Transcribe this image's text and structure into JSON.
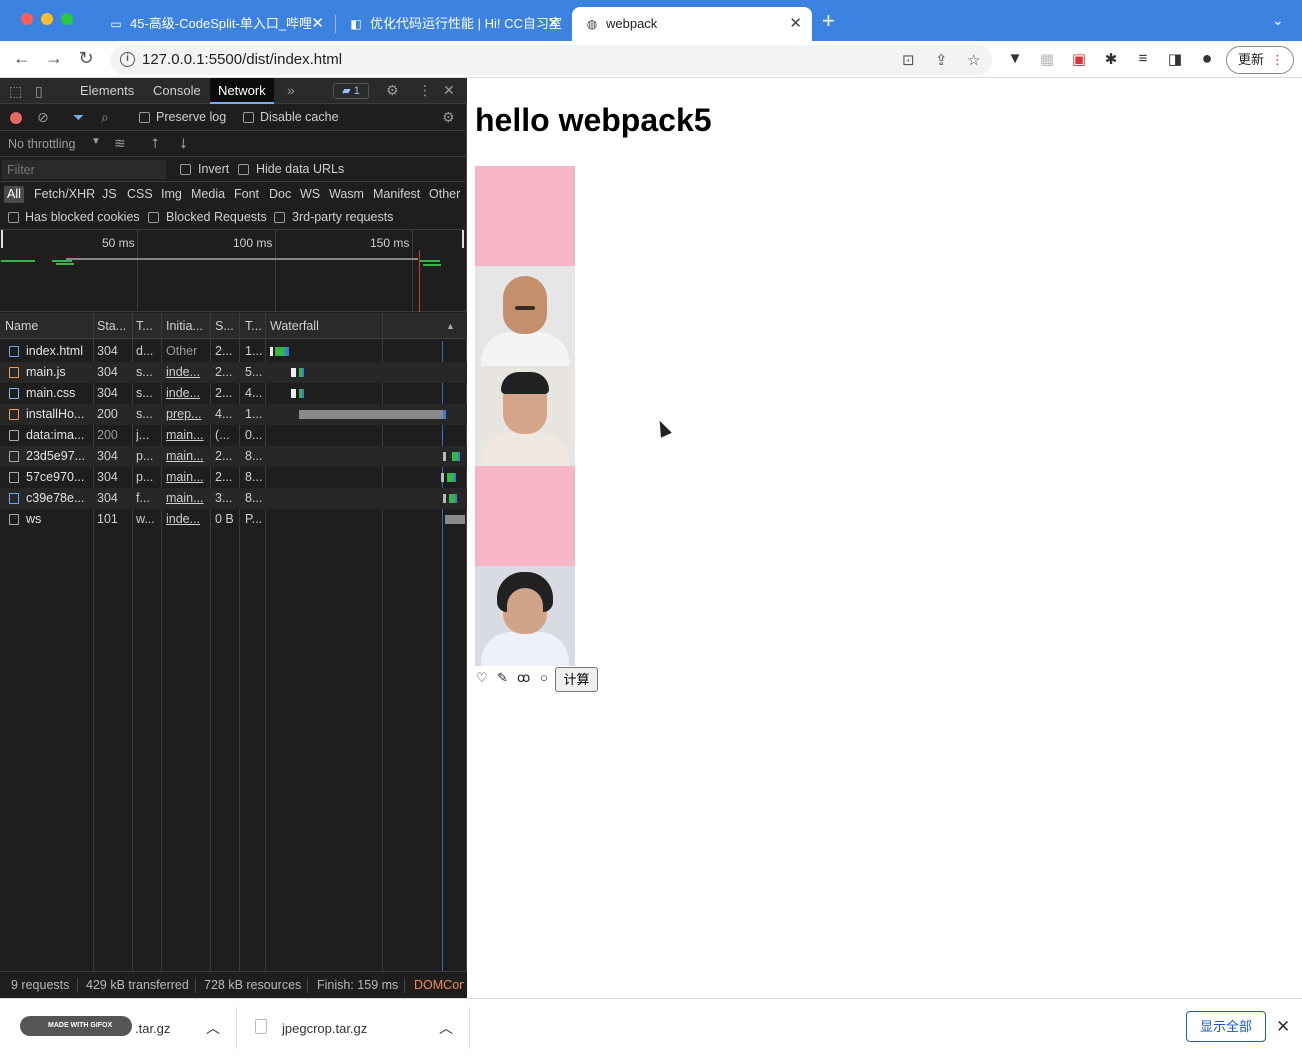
{
  "browser": {
    "tabs": [
      {
        "title": "45-高级-CodeSplit-单入口_哔哩",
        "icon": "tv-icon",
        "active": false
      },
      {
        "title": "优化代码运行性能 | Hi! CC自习室",
        "icon": "bookmark-icon",
        "active": false
      },
      {
        "title": "webpack",
        "icon": "globe-icon",
        "active": true
      }
    ],
    "url": "127.0.0.1:5500/dist/index.html",
    "update_label": "更新"
  },
  "devtools": {
    "panels": [
      "Elements",
      "Console",
      "Network"
    ],
    "active_panel": "Network",
    "message_count": "1",
    "preserve_log": "Preserve log",
    "disable_cache": "Disable cache",
    "throttling": "No throttling",
    "filter_placeholder": "Filter",
    "invert": "Invert",
    "hide_data_urls": "Hide data URLs",
    "type_filters": [
      "All",
      "Fetch/XHR",
      "JS",
      "CSS",
      "Img",
      "Media",
      "Font",
      "Doc",
      "WS",
      "Wasm",
      "Manifest",
      "Other"
    ],
    "active_filter": "All",
    "has_blocked_cookies": "Has blocked cookies",
    "blocked_requests": "Blocked Requests",
    "third_party": "3rd-party requests",
    "timeline_ticks": [
      "50 ms",
      "100 ms",
      "150 ms"
    ],
    "columns": [
      "Name",
      "Sta...",
      "T...",
      "Initia...",
      "S...",
      "T...",
      "Waterfall"
    ],
    "rows": [
      {
        "name": "index.html",
        "status": "304",
        "type": "d...",
        "initiator": "Other",
        "size": "2...",
        "time": "1...",
        "icon_color": "#6ea6ff",
        "initiator_link": false
      },
      {
        "name": "main.js",
        "status": "304",
        "type": "s...",
        "initiator": "inde...",
        "size": "2...",
        "time": "5...",
        "icon_color": "#f2994a",
        "initiator_link": true
      },
      {
        "name": "main.css",
        "status": "304",
        "type": "s...",
        "initiator": "inde...",
        "size": "2...",
        "time": "4...",
        "icon_color": "#8ab4f8",
        "initiator_link": true
      },
      {
        "name": "installHo...",
        "status": "200",
        "type": "s...",
        "initiator": "prep...",
        "size": "4...",
        "time": "1...",
        "icon_color": "#f2994a",
        "initiator_link": true
      },
      {
        "name": "data:ima...",
        "status": "200",
        "type": "j...",
        "initiator": "main...",
        "size": "(...",
        "time": "0...",
        "icon_color": "#aaaaaa",
        "initiator_link": true
      },
      {
        "name": "23d5e97...",
        "status": "304",
        "type": "p...",
        "initiator": "main...",
        "size": "2...",
        "time": "8...",
        "icon_color": "#aaaaaa",
        "initiator_link": true
      },
      {
        "name": "57ce970...",
        "status": "304",
        "type": "p...",
        "initiator": "main...",
        "size": "2...",
        "time": "8...",
        "icon_color": "#aaaaaa",
        "initiator_link": true
      },
      {
        "name": "c39e78e...",
        "status": "304",
        "type": "f...",
        "initiator": "main...",
        "size": "3...",
        "time": "8...",
        "icon_color": "#6ea6ff",
        "initiator_link": true
      },
      {
        "name": "ws",
        "status": "101",
        "type": "w...",
        "initiator": "inde...",
        "size": "0 B",
        "time": "P...",
        "icon_color": "#aaaaaa",
        "initiator_link": true
      }
    ],
    "status_bar": {
      "requests": "9 requests",
      "transferred": "429 kB transferred",
      "resources": "728 kB resources",
      "finish": "Finish: 159 ms",
      "domcontent": "DOMCon"
    }
  },
  "page": {
    "heading": "hello webpack5",
    "button_label": "计算"
  },
  "downloads": {
    "items": [
      ".tar.gz",
      "jpegcrop.tar.gz"
    ],
    "gifox_badge": "MADE WITH GIFOX",
    "show_all": "显示全部"
  }
}
